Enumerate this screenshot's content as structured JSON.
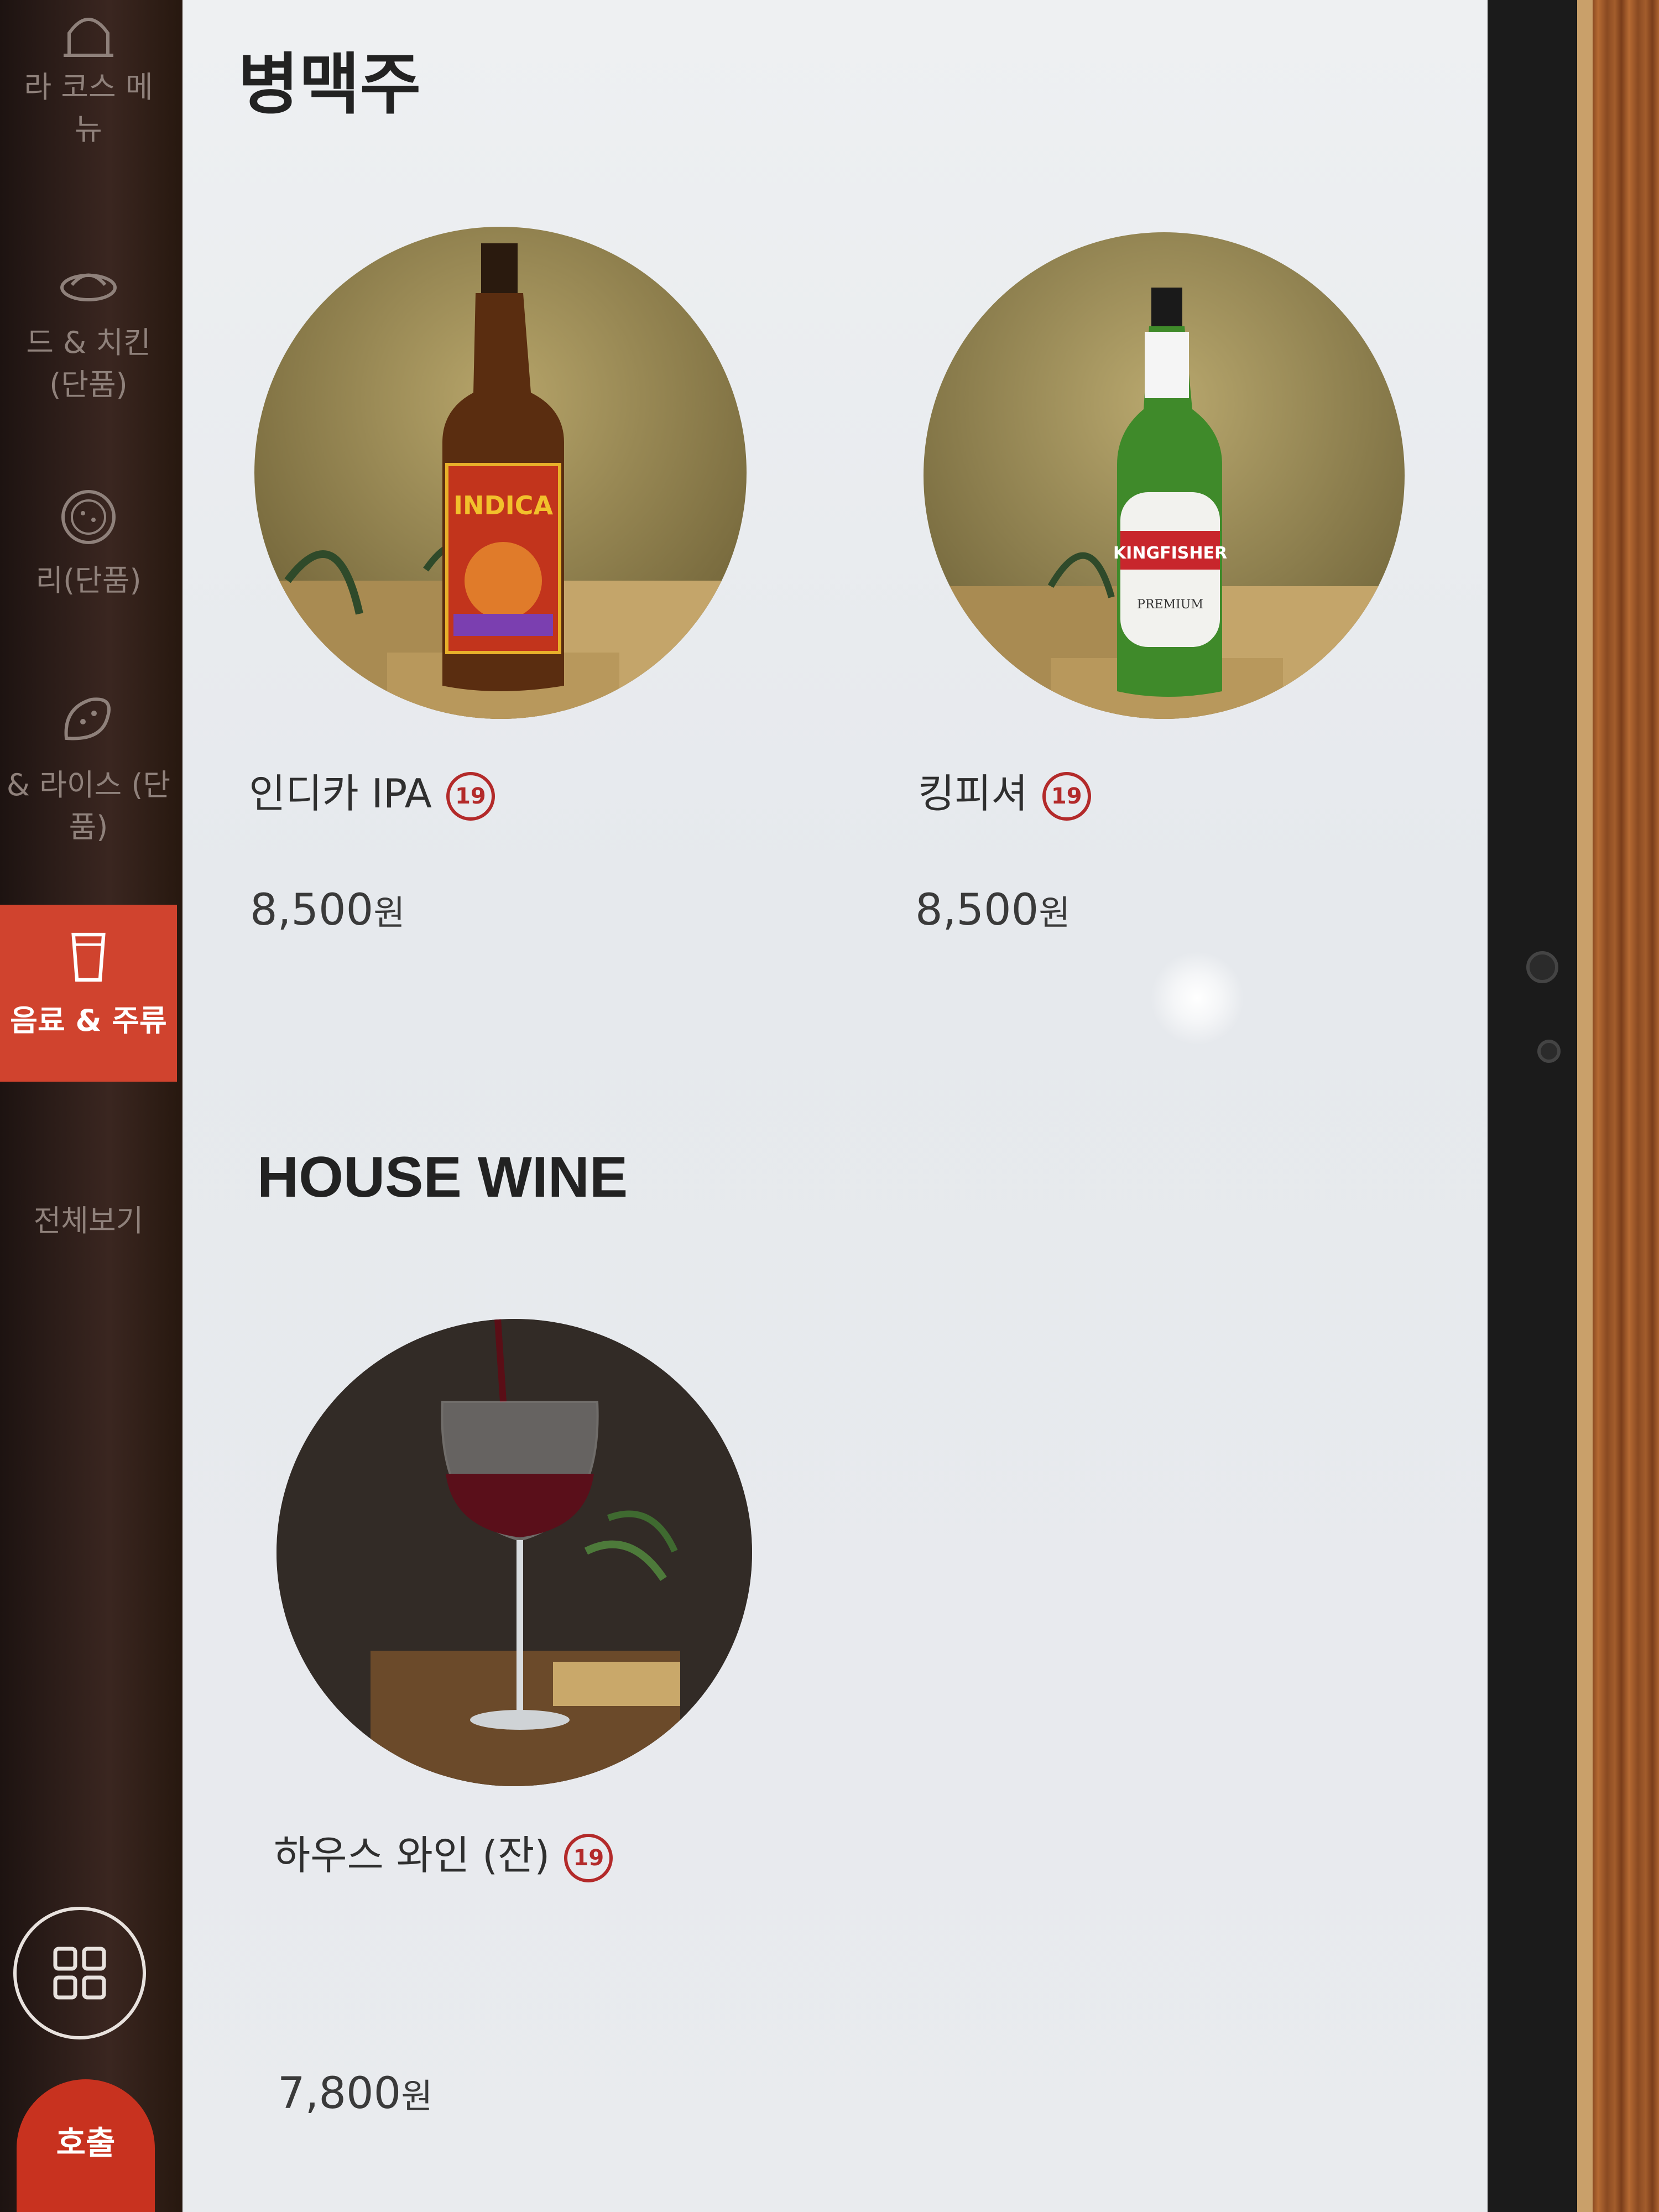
{
  "sidebar": {
    "categories": [
      {
        "label": "라 코스 메\n뉴",
        "icon": "taj-mahal-icon"
      },
      {
        "label": "드 & 치킨\n(단품)",
        "icon": "plate-icon"
      },
      {
        "label": "리(단품)",
        "icon": "curry-bowl-icon"
      },
      {
        "label": "& 라이스 (단\n품)",
        "icon": "naan-icon"
      },
      {
        "label": "음료 & 주류",
        "icon": "glass-icon",
        "active": true
      },
      {
        "label": "전체보기",
        "icon": ""
      }
    ],
    "call_label": "호출",
    "grid_icon": "grid-icon"
  },
  "sections": [
    {
      "title": "병맥주",
      "items": [
        {
          "name": "인디카 IPA",
          "age_badge": "19",
          "price": "8,500",
          "currency": "원",
          "image": "indica-beer-bottle"
        },
        {
          "name": "킹피셔",
          "age_badge": "19",
          "price": "8,500",
          "currency": "원",
          "image": "kingfisher-beer-bottle"
        }
      ]
    },
    {
      "title": "HOUSE WINE",
      "items": [
        {
          "name": "하우스 와인 (잔)",
          "age_badge": "19",
          "price": "7,800",
          "currency": "원",
          "image": "red-wine-glass"
        }
      ]
    }
  ],
  "bottle_labels": {
    "indica": "INDICA",
    "kingfisher": "KINGFISHER",
    "kingfisher_sub": "PREMIUM"
  },
  "colors": {
    "accent": "#d0432e",
    "age_badge": "#b32a2a",
    "sidebar_bg": "#2a1b16",
    "screen_bg": "#eceef1"
  }
}
